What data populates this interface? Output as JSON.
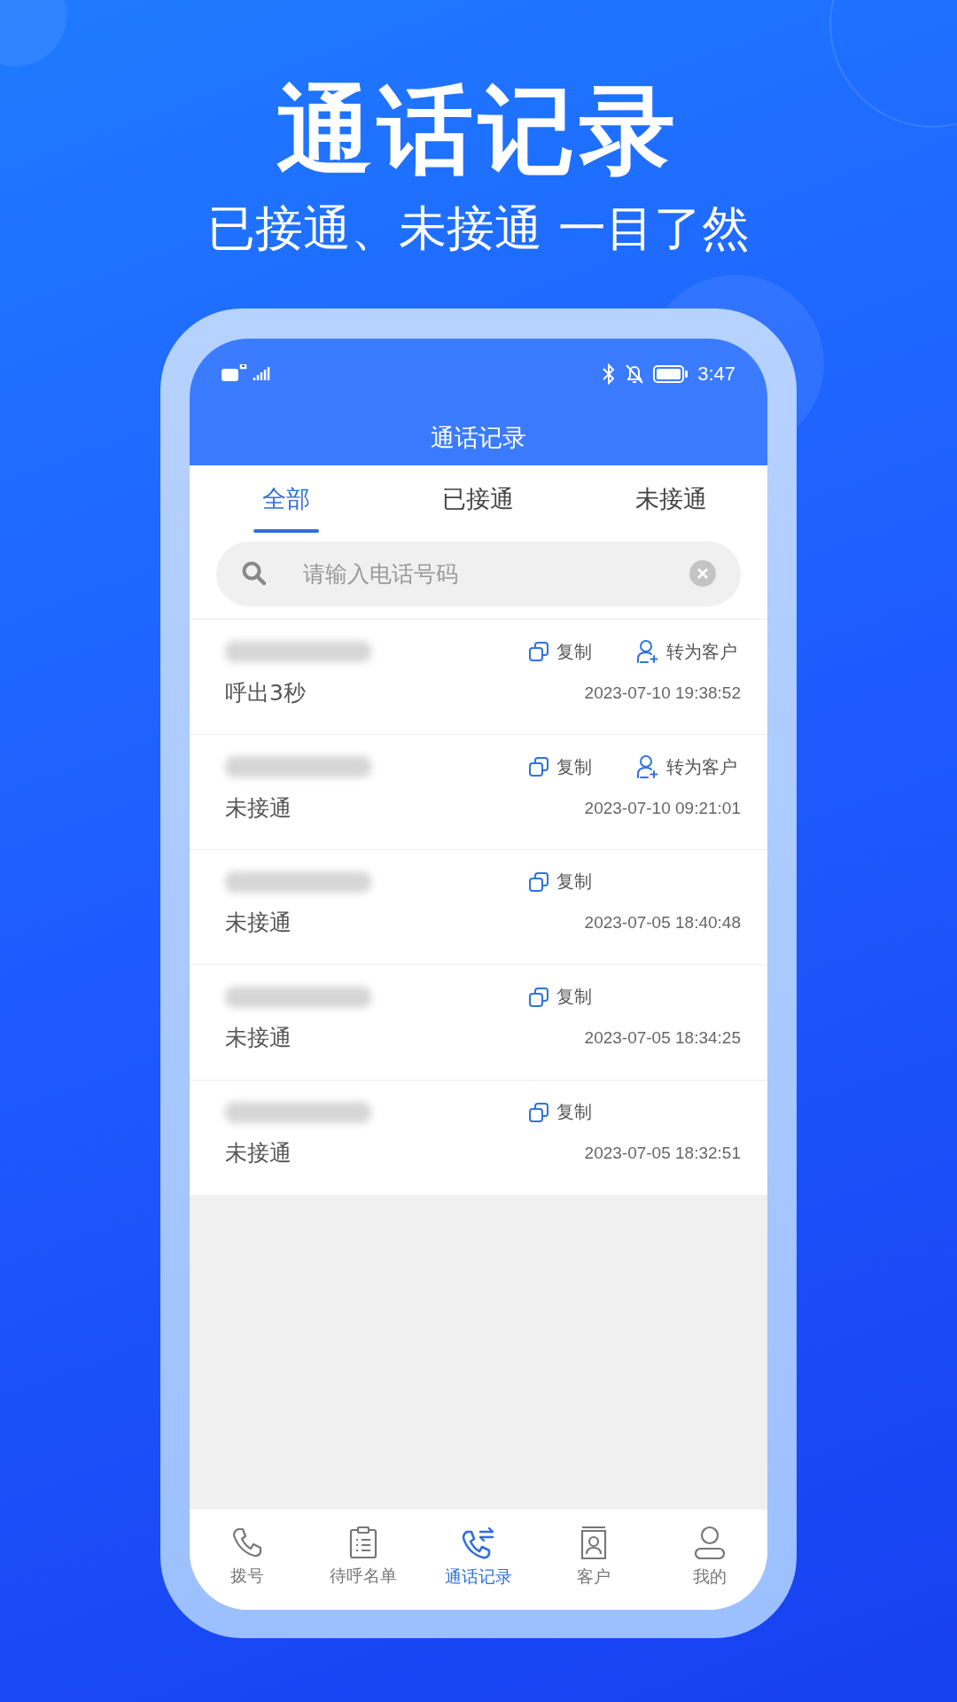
{
  "headline": "通话记录",
  "subheadline": "已接通、未接通 一目了然",
  "status_bar": {
    "time": "3:47"
  },
  "app_bar": {
    "title": "通话记录"
  },
  "tabs": [
    {
      "label": "全部",
      "selected": true
    },
    {
      "label": "已接通",
      "selected": false
    },
    {
      "label": "未接通",
      "selected": false
    }
  ],
  "search": {
    "placeholder": "请输入电话号码"
  },
  "records": [
    {
      "status": "呼出3秒",
      "time": "2023-07-10 19:38:52",
      "actions": [
        {
          "kind": "copy",
          "label": "复制"
        },
        {
          "kind": "convert",
          "label": "转为客户"
        }
      ]
    },
    {
      "status": "未接通",
      "time": "2023-07-10 09:21:01",
      "actions": [
        {
          "kind": "copy",
          "label": "复制"
        },
        {
          "kind": "convert",
          "label": "转为客户"
        }
      ]
    },
    {
      "status": "未接通",
      "time": "2023-07-05 18:40:48",
      "actions": [
        {
          "kind": "copy",
          "label": "复制"
        }
      ]
    },
    {
      "status": "未接通",
      "time": "2023-07-05 18:34:25",
      "actions": [
        {
          "kind": "copy",
          "label": "复制"
        }
      ]
    },
    {
      "status": "未接通",
      "time": "2023-07-05 18:32:51",
      "actions": [
        {
          "kind": "copy",
          "label": "复制"
        }
      ]
    }
  ],
  "bottom_nav": [
    {
      "kind": "phone",
      "label": "拨号",
      "selected": false
    },
    {
      "kind": "clipboard",
      "label": "待呼名单",
      "selected": false
    },
    {
      "kind": "calllog",
      "label": "通话记录",
      "selected": true
    },
    {
      "kind": "contact",
      "label": "客户",
      "selected": false
    },
    {
      "kind": "person",
      "label": "我的",
      "selected": false
    }
  ]
}
